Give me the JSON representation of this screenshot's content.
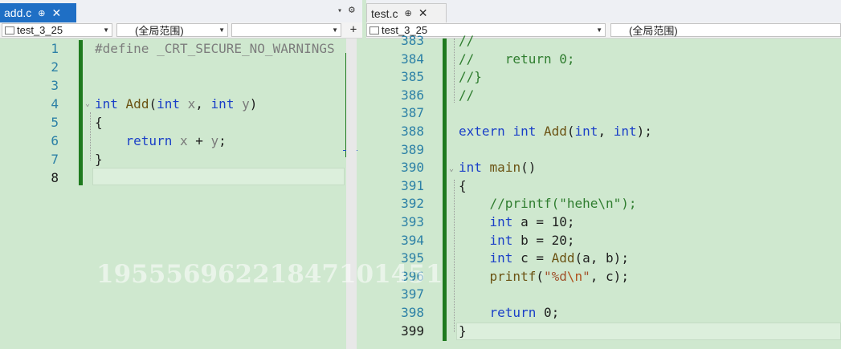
{
  "left_editor": {
    "tab": {
      "name": "add.c",
      "pin": "⊕",
      "close": "✕"
    },
    "nav": {
      "project": "test_3_25",
      "scope": "(全局范围)",
      "member": ""
    },
    "split_button": "+",
    "overflow_arrow": "▾",
    "gear": "⚙",
    "lines": [
      {
        "number": "1",
        "segments": [
          {
            "t": "#define _CRT_SECURE_NO_WARNINGS",
            "c": "pp"
          }
        ]
      },
      {
        "number": "2",
        "segments": []
      },
      {
        "number": "3",
        "segments": []
      },
      {
        "number": "4",
        "segments": [
          {
            "t": "int",
            "c": "kw"
          },
          {
            "t": " "
          },
          {
            "t": "Add",
            "c": "fn"
          },
          {
            "t": "("
          },
          {
            "t": "int",
            "c": "kw"
          },
          {
            "t": " "
          },
          {
            "t": "x",
            "c": "param"
          },
          {
            "t": ", "
          },
          {
            "t": "int",
            "c": "kw"
          },
          {
            "t": " "
          },
          {
            "t": "y",
            "c": "param"
          },
          {
            "t": ")"
          }
        ]
      },
      {
        "number": "5",
        "segments": [
          {
            "t": "{"
          }
        ]
      },
      {
        "number": "6",
        "segments": [
          {
            "t": "    "
          },
          {
            "t": "return",
            "c": "kw"
          },
          {
            "t": " "
          },
          {
            "t": "x",
            "c": "param"
          },
          {
            "t": " + "
          },
          {
            "t": "y",
            "c": "param"
          },
          {
            "t": ";"
          }
        ]
      },
      {
        "number": "7",
        "segments": [
          {
            "t": "}"
          }
        ]
      },
      {
        "number": "8",
        "segments": []
      }
    ]
  },
  "right_editor": {
    "tab": {
      "name": "test.c",
      "pin": "⊕",
      "close": "✕"
    },
    "nav": {
      "project": "test_3_25",
      "scope": "(全局范围)"
    },
    "lines": [
      {
        "number": "383",
        "segments": [
          {
            "t": "//",
            "c": "cm"
          }
        ]
      },
      {
        "number": "384",
        "segments": [
          {
            "t": "//    return 0;",
            "c": "cm"
          }
        ]
      },
      {
        "number": "385",
        "segments": [
          {
            "t": "//}",
            "c": "cm"
          }
        ]
      },
      {
        "number": "386",
        "segments": [
          {
            "t": "//",
            "c": "cm"
          }
        ]
      },
      {
        "number": "387",
        "segments": []
      },
      {
        "number": "388",
        "segments": [
          {
            "t": "extern",
            "c": "kw"
          },
          {
            "t": " "
          },
          {
            "t": "int",
            "c": "kw"
          },
          {
            "t": " "
          },
          {
            "t": "Add",
            "c": "fn"
          },
          {
            "t": "("
          },
          {
            "t": "int",
            "c": "kw"
          },
          {
            "t": ", "
          },
          {
            "t": "int",
            "c": "kw"
          },
          {
            "t": ");"
          }
        ]
      },
      {
        "number": "389",
        "segments": []
      },
      {
        "number": "390",
        "segments": [
          {
            "t": "int",
            "c": "kw"
          },
          {
            "t": " "
          },
          {
            "t": "main",
            "c": "fn"
          },
          {
            "t": "()"
          }
        ]
      },
      {
        "number": "391",
        "segments": [
          {
            "t": "{"
          }
        ]
      },
      {
        "number": "392",
        "segments": [
          {
            "t": "    "
          },
          {
            "t": "//printf(\"hehe\\n\");",
            "c": "cm"
          }
        ]
      },
      {
        "number": "393",
        "segments": [
          {
            "t": "    "
          },
          {
            "t": "int",
            "c": "kw"
          },
          {
            "t": " a = 10;"
          }
        ]
      },
      {
        "number": "394",
        "segments": [
          {
            "t": "    "
          },
          {
            "t": "int",
            "c": "kw"
          },
          {
            "t": " b = 20;"
          }
        ]
      },
      {
        "number": "395",
        "segments": [
          {
            "t": "    "
          },
          {
            "t": "int",
            "c": "kw"
          },
          {
            "t": " c = "
          },
          {
            "t": "Add",
            "c": "fn"
          },
          {
            "t": "(a, b);"
          }
        ]
      },
      {
        "number": "396",
        "segments": [
          {
            "t": "    "
          },
          {
            "t": "printf",
            "c": "fn"
          },
          {
            "t": "("
          },
          {
            "t": "\"%d",
            "c": "str"
          },
          {
            "t": "\\n",
            "c": "esc"
          },
          {
            "t": "\"",
            "c": "str"
          },
          {
            "t": ", c);"
          }
        ]
      },
      {
        "number": "397",
        "segments": []
      },
      {
        "number": "398",
        "segments": [
          {
            "t": "    "
          },
          {
            "t": "return",
            "c": "kw"
          },
          {
            "t": " 0;"
          }
        ]
      },
      {
        "number": "399",
        "segments": [
          {
            "t": "}"
          }
        ]
      }
    ]
  },
  "watermark": "19555696221847101451"
}
